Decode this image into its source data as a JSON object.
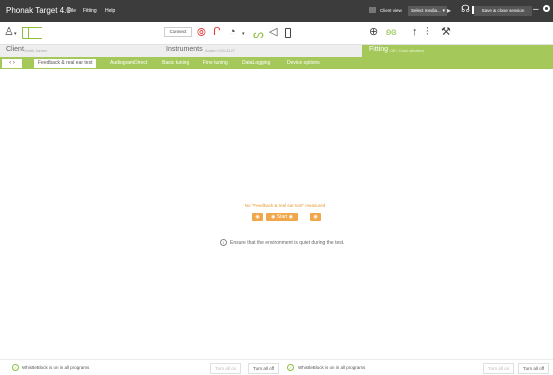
{
  "titlebar": {
    "app_title": "Phonak Target 4.0",
    "menu": [
      "File",
      "Fitting",
      "Help"
    ],
    "client_view": "Client view",
    "select_media": "Select media...",
    "save_close": "Save & close session"
  },
  "toolbar": {
    "connect_label": "Connect"
  },
  "sections": {
    "client": {
      "title": "Client",
      "subtitle": "Smith James"
    },
    "instruments": {
      "title": "Instruments",
      "subtitle": "Audéo V90-312T"
    },
    "fitting": {
      "title": "Fitting",
      "subtitle": "Off / Calm situation"
    }
  },
  "tabs": [
    {
      "label": "Feedback & real ear test",
      "active": true
    },
    {
      "label": "AudiogramDirect"
    },
    {
      "label": "Basic tuning"
    },
    {
      "label": "Fine tuning"
    },
    {
      "label": "DataLogging"
    },
    {
      "label": "Device options"
    }
  ],
  "main": {
    "not_measured": "No \"Feedback & real ear test\" measured",
    "start_label": "Start",
    "info_text": "Ensure that the environment is quiet during the test."
  },
  "bottom": {
    "left_status": "WhistleBlock is on in all programs",
    "right_status": "WhistleBlock is on in all programs",
    "turn_all_on": "Turn all on",
    "turn_all_off": "Turn all off"
  },
  "colors": {
    "accent_green": "#a5c85a",
    "orange": "#f0a64a",
    "titlebar": "#3c3c3c"
  }
}
